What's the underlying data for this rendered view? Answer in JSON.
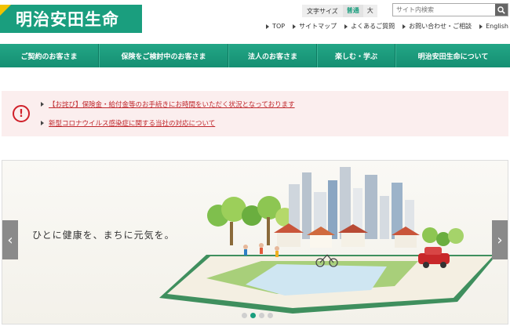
{
  "brand": {
    "name": "明治安田生命",
    "color": "#1a9e7e",
    "accent": "#f2c200"
  },
  "font_size_control": {
    "label": "文字サイズ",
    "options": [
      "普通",
      "大"
    ],
    "selected": "普通"
  },
  "search": {
    "placeholder": "サイト内検索",
    "icon": "search-icon"
  },
  "utility_nav": [
    "TOP",
    "サイトマップ",
    "よくあるご質問",
    "お問い合わせ・ご相談",
    "English"
  ],
  "main_nav": [
    "ご契約のお客さま",
    "保険をご検討中のお客さま",
    "法人のお客さま",
    "楽しむ・学ぶ",
    "明治安田生命について"
  ],
  "notice": {
    "icon": "alert-icon",
    "icon_glyph": "!",
    "links": [
      "【お詫び】保険金・給付金等のお手続きにお時間をいただく状況となっております",
      "新型コロナウイルス感染症に関する当社の対応について"
    ]
  },
  "hero": {
    "tagline": "ひとに健康を、まちに元気を。",
    "slide_count": 4,
    "active_slide": 2,
    "prev_glyph": "‹",
    "next_glyph": "›"
  }
}
